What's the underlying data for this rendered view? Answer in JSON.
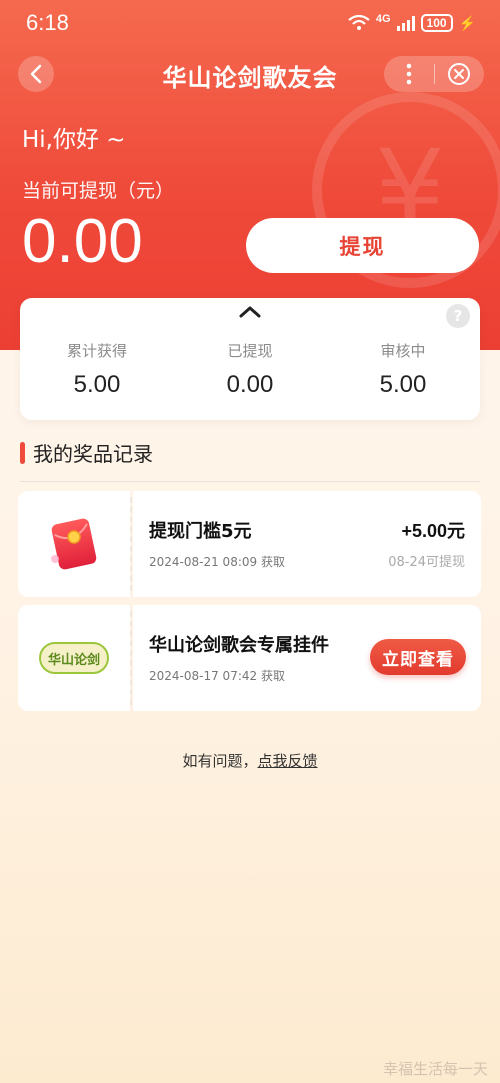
{
  "status_bar": {
    "time": "6:18",
    "network": "4G",
    "battery": "100"
  },
  "nav": {
    "title": "华山论剑歌友会"
  },
  "header": {
    "greeting": "Hi,你好 ~",
    "balance_label": "当前可提现（元）",
    "balance": "0.00",
    "withdraw_label": "提现"
  },
  "stats": [
    {
      "label": "累计获得",
      "value": "5.00"
    },
    {
      "label": "已提现",
      "value": "0.00"
    },
    {
      "label": "审核中",
      "value": "5.00"
    }
  ],
  "section": {
    "title": "我的奖品记录"
  },
  "records": [
    {
      "icon": "red-envelope-icon",
      "title": "提现门槛5元",
      "time": "2024-08-21 08:09 获取",
      "amount": "+5.00元",
      "status": "08-24可提现"
    },
    {
      "icon": "huashan-badge-icon",
      "badge_text": "华山论剑",
      "title": "华山论剑歌会专属挂件",
      "time": "2024-08-17 07:42 获取",
      "action_label": "立即查看"
    }
  ],
  "feedback": {
    "prefix": "如有问题，",
    "link": "点我反馈"
  },
  "watermark": "幸福生活每一天",
  "colors": {
    "primary": "#ef4a3a",
    "background": "#fff3e6"
  }
}
